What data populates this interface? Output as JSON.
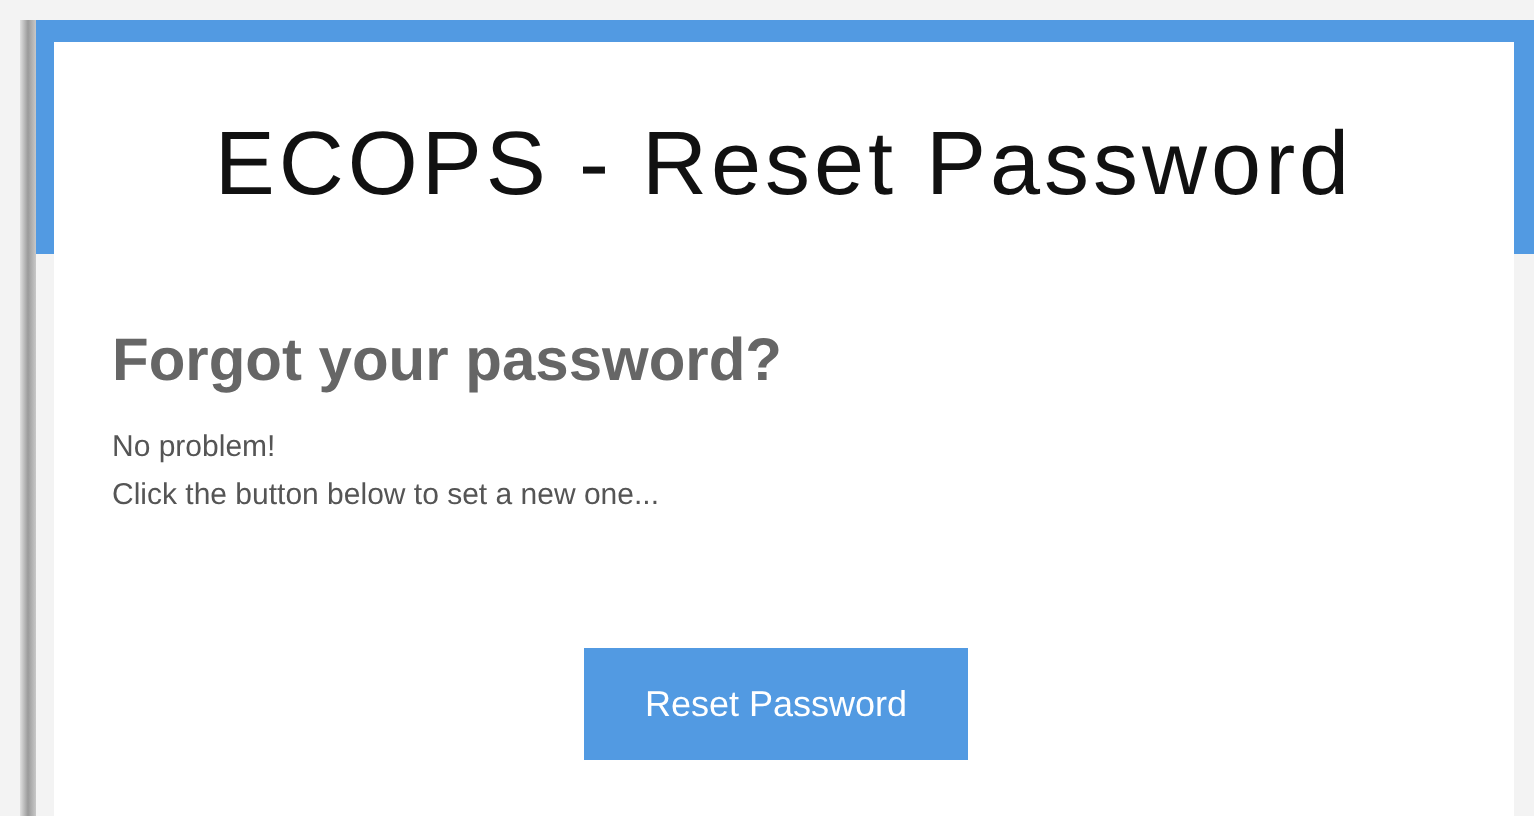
{
  "header": {
    "title": "ECOPS - Reset Password"
  },
  "content": {
    "heading": "Forgot your password?",
    "lines": [
      "No problem!",
      "Click the button below to set a new one..."
    ]
  },
  "button": {
    "label": "Reset Password"
  }
}
